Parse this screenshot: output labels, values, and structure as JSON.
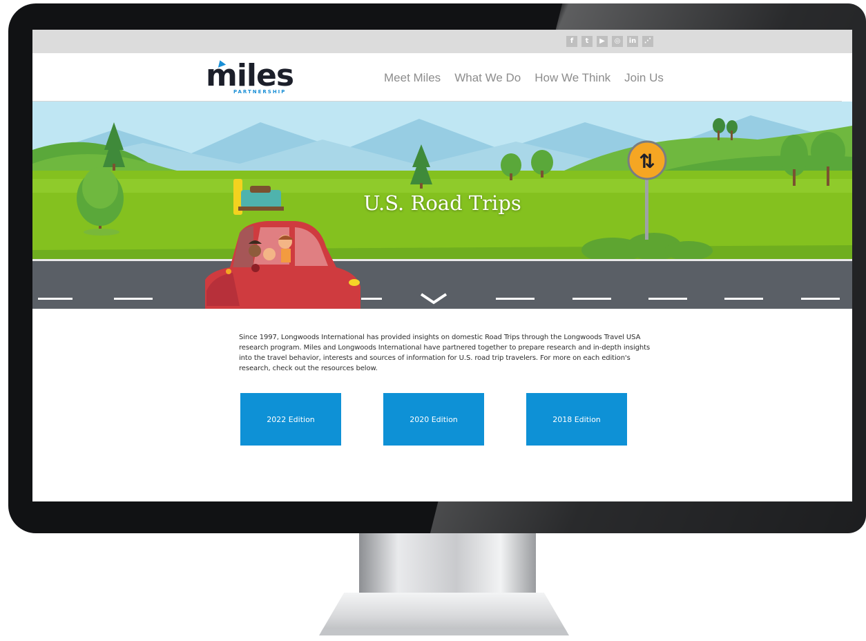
{
  "social": {
    "icons": [
      {
        "name": "facebook-icon",
        "glyph": "f"
      },
      {
        "name": "twitter-icon",
        "glyph": "t"
      },
      {
        "name": "youtube-icon",
        "glyph": "▶"
      },
      {
        "name": "instagram-icon",
        "glyph": "◎"
      },
      {
        "name": "linkedin-icon",
        "glyph": "in"
      },
      {
        "name": "rss-icon",
        "glyph": "⋰"
      }
    ]
  },
  "header": {
    "logo_word": "miles",
    "logo_sub": "PARTNERSHIP",
    "nav": [
      "Meet Miles",
      "What We Do",
      "How We Think",
      "Join Us"
    ]
  },
  "hero": {
    "title": "U.S. Road Trips"
  },
  "main": {
    "intro": "Since 1997, Longwoods International has provided insights on domestic Road Trips through the Longwoods Travel USA research program. Miles and Longwoods International have partnered together to prepare research and in-depth insights into the travel behavior, interests and sources of information for U.S. road trip travelers. For more on each edition's research, check out the resources below.",
    "editions": [
      "2022 Edition",
      "2020 Edition",
      "2018 Edition"
    ]
  },
  "colors": {
    "accent_blue": "#0e91d6",
    "brand_dark": "#1c1f2a",
    "sky": "#bfe6f3",
    "grass": "#84c11f",
    "road": "#5a5f66",
    "car_red": "#cf3b3f"
  }
}
